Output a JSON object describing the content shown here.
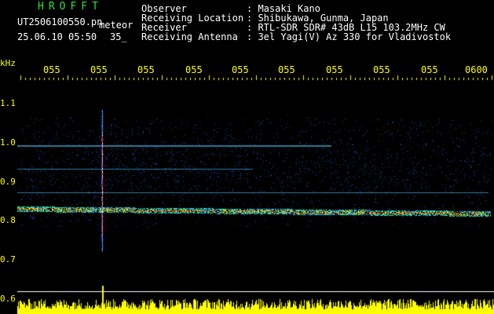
{
  "header": {
    "brand": "HROFFT",
    "filename": "UT2506100550.pn",
    "tag": "meteor",
    "datetime": "25.06.10 05:50",
    "count": "35_"
  },
  "info": [
    {
      "label": "Observer",
      "value": ": Masaki Kano"
    },
    {
      "label": "Receiving Location",
      "value": ": Shibukawa, Gunma, Japan"
    },
    {
      "label": "Receiver",
      "value": ": RTL-SDR SDR# 43dB L15 103.2MHz CW"
    },
    {
      "label": "Receiving Antenna",
      "value": ": 3el Yagi(V) Az 330 for Vladivostok"
    }
  ],
  "axes": {
    "y_unit": "kHz",
    "y_ticks": [
      "1.1",
      "1.0",
      "0.9",
      "0.8",
      "0.7",
      "0.6"
    ],
    "x_ticks": [
      "055",
      "055",
      "055",
      "055",
      "055",
      "055",
      "055",
      "055",
      "055",
      "0600"
    ]
  },
  "colors": {
    "background": "#000000",
    "text": "#ffffff",
    "brand": "#33e033",
    "axis": "#ffff00",
    "noise_blue": "#1a3cff",
    "signal_band": "#ff3300"
  }
}
